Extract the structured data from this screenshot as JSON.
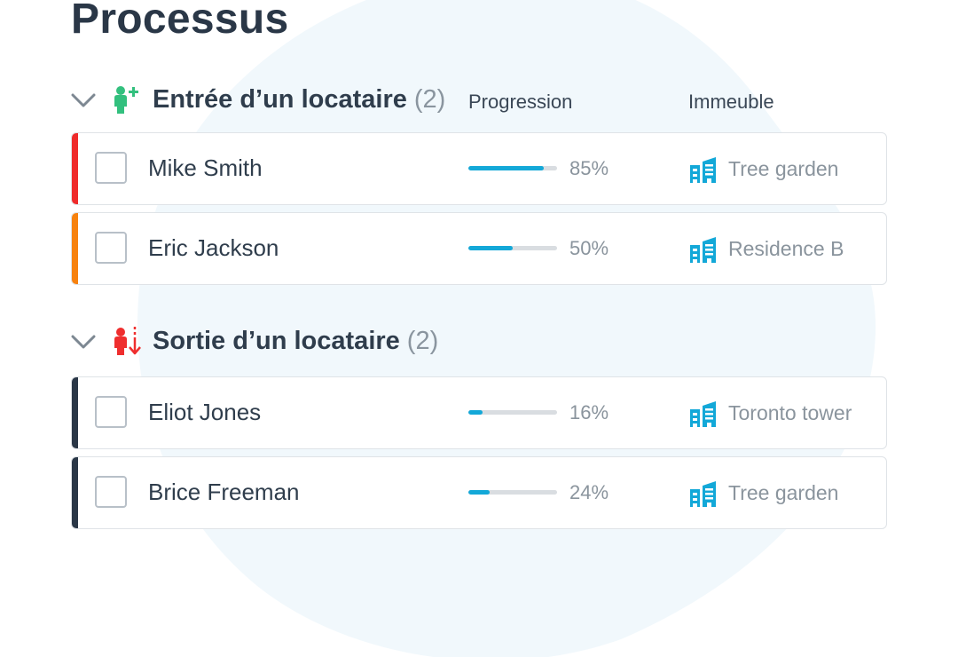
{
  "page": {
    "title": "Processus"
  },
  "colors": {
    "progress": "#13a8d8",
    "building_icon": "#13a8d8",
    "entry_icon": "#33c07e",
    "exit_icon": "#ef2e2e",
    "accent_red": "#ef2b2b",
    "accent_orange": "#f7820f",
    "accent_dark": "#2a3747"
  },
  "groups": [
    {
      "title": "Entrée d’un locataire",
      "count": "(2)",
      "icon": "person-plus-icon",
      "columns": {
        "progress": "Progression",
        "building": "Immeuble"
      },
      "rows": [
        {
          "name": "Mike Smith",
          "progress": 0.85,
          "progress_label": "85%",
          "building": "Tree garden",
          "accent": "#ef2b2b"
        },
        {
          "name": "Eric Jackson",
          "progress": 0.5,
          "progress_label": "50%",
          "building": "Residence B",
          "accent": "#f7820f"
        }
      ]
    },
    {
      "title": "Sortie d’un locataire",
      "count": "(2)",
      "icon": "person-exit-icon",
      "rows": [
        {
          "name": "Eliot Jones",
          "progress": 0.16,
          "progress_label": "16%",
          "building": "Toronto tower",
          "accent": "#2a3747"
        },
        {
          "name": "Brice Freeman",
          "progress": 0.24,
          "progress_label": "24%",
          "building": "Tree garden",
          "accent": "#2a3747"
        }
      ]
    }
  ]
}
